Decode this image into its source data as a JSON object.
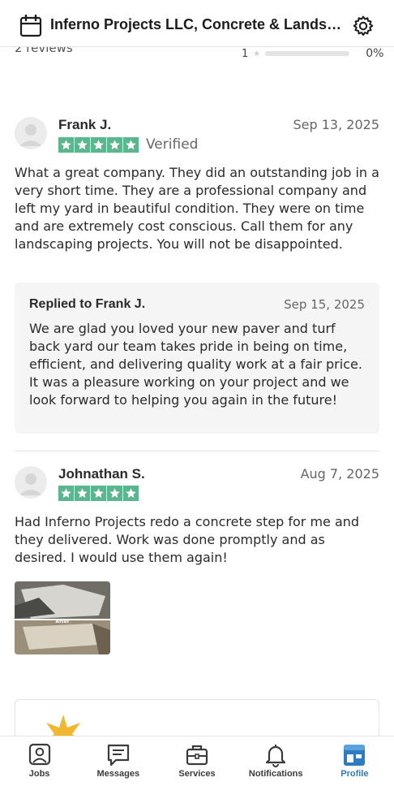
{
  "header": {
    "title": "Inferno Projects LLC, Concrete & Landscaping",
    "calendar_icon": "calendar-icon",
    "settings_icon": "gear-icon"
  },
  "summary": {
    "review_count": "2 reviews",
    "rating_row": {
      "star_label": "1",
      "percent": "0%"
    }
  },
  "reviews": [
    {
      "name": "Frank J.",
      "date": "Sep 13, 2025",
      "rating": 5,
      "verified": "Verified",
      "body": "What a great company. They did an outstanding job in a very short time. They are a professional company and left my yard in beautiful condition. They were on time and are extremely cost conscious. Call them for any landscaping projects. You will not be disappointed.",
      "reply": {
        "title": "Replied to Frank J.",
        "date": "Sep 15, 2025",
        "body": "We are glad you loved your new paver and turf back yard our team takes pride in being on time, efficient, and delivering quality work at a fair price. It was a pleasure working on your project and we look forward to helping you again in the future!"
      }
    },
    {
      "name": "Johnathan S.",
      "date": "Aug 7, 2025",
      "rating": 5,
      "body": "Had Inferno Projects redo a concrete step for me and they delivered. Work was done promptly and as desired. I would use them again!",
      "photo_label": "After"
    }
  ],
  "tabs": [
    {
      "label": "Jobs",
      "icon": "person-badge-icon",
      "active": false
    },
    {
      "label": "Messages",
      "icon": "message-icon",
      "active": false
    },
    {
      "label": "Services",
      "icon": "briefcase-icon",
      "active": false
    },
    {
      "label": "Notifications",
      "icon": "bell-icon",
      "active": false
    },
    {
      "label": "Profile",
      "icon": "storefront-icon",
      "active": true
    }
  ],
  "colors": {
    "star_green": "#5bb58f",
    "active_tab": "#2b7dbf",
    "reply_bg": "#f5f5f5",
    "promo_star": "#f2b730"
  }
}
